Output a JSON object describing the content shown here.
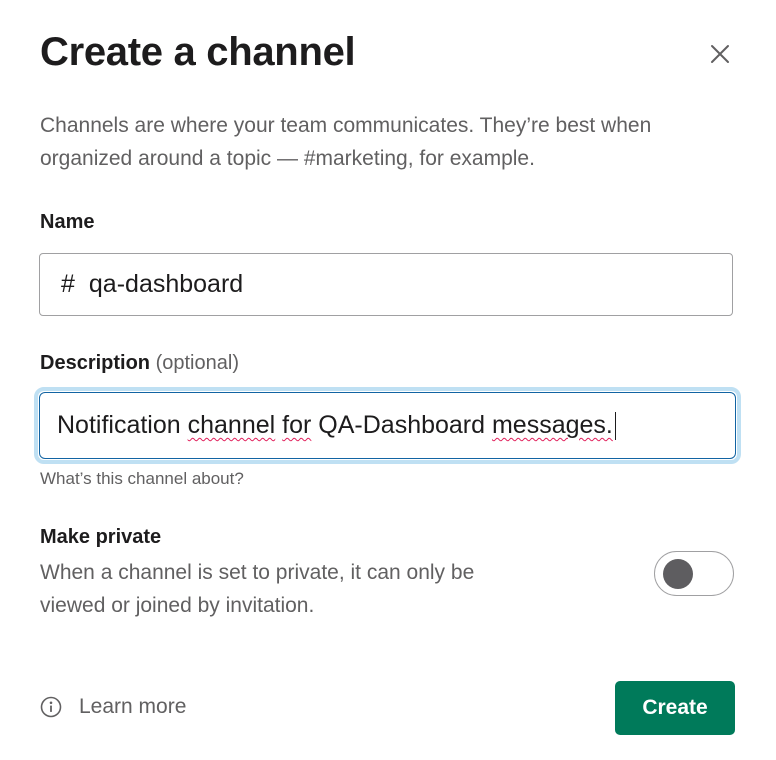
{
  "modal": {
    "title": "Create a channel",
    "intro": "Channels are where your team communicates. They’re best when organized around a topic — #marketing, for example."
  },
  "name_section": {
    "label": "Name",
    "prefix": "#",
    "value": "qa-dashboard"
  },
  "description_section": {
    "label": "Description",
    "optional_label": "(optional)",
    "value_parts": [
      "Notification ",
      "channel",
      " ",
      "for",
      " QA-Dashboard ",
      "messages."
    ],
    "hint": "What’s this channel about?"
  },
  "private_section": {
    "label": "Make private",
    "description": "When a channel is set to private, it can only be viewed or joined by invitation.",
    "enabled": false
  },
  "footer": {
    "learn_more": "Learn more",
    "create_label": "Create"
  },
  "colors": {
    "primary": "#007a5a",
    "focus_ring": "#bfe0f3",
    "focus_border": "#1264a3",
    "spellcheck": "#e01e5a"
  }
}
